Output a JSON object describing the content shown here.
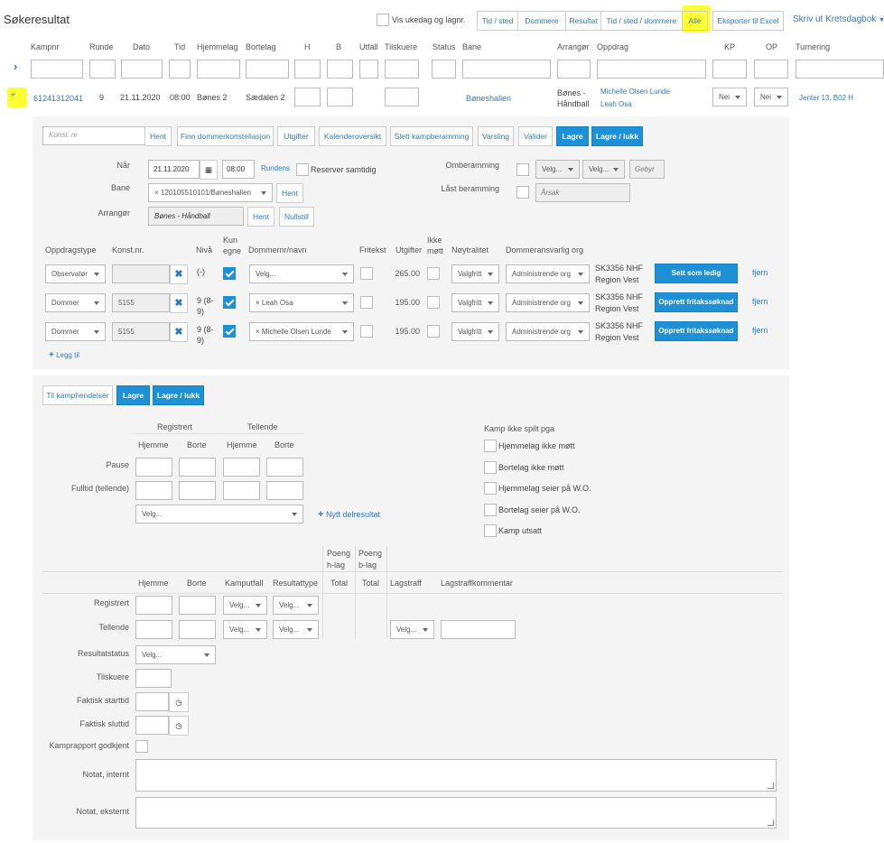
{
  "page": {
    "title": "Søkeresultat"
  },
  "toolbar": {
    "show_weekday_label": "Vis ukedag og lagnr.",
    "filter_buttons": [
      "Tid / sted",
      "Dommere",
      "Resultat",
      "Tid / sted / dommere",
      "Alle"
    ],
    "export_label": "Eksporter til Excel",
    "print_label": "Skriv ut Kretsdagbok"
  },
  "table": {
    "columns": [
      "Kampnr",
      "Runde",
      "Dato",
      "Tid",
      "Hjemmelag",
      "Bortelag",
      "H",
      "B",
      "Utfall",
      "Tilskuere",
      "Status",
      "Bane",
      "Arrangør",
      "Oppdrag",
      "KP",
      "OP",
      "Turnering"
    ],
    "row": {
      "kampnr": "61241312041",
      "runde": "9",
      "dato": "21.11.2020",
      "tid": "08:00",
      "hjemmelag": "Bønes 2",
      "bortelag": "Sædalen 2",
      "bane": "Bøneshallen",
      "arrangor": "Bønes - Håndball",
      "oppdrag1": "Michelle Olsen Lunde",
      "oppdrag2": "Leah Osa",
      "kp": "Nei",
      "op": "Nei",
      "turnering": "Jenter 13, B02 H"
    }
  },
  "match_toolbar": {
    "konst_placeholder": "Konst. nr",
    "hent": "Hent",
    "buttons": [
      "Finn dommerkonstellasjon",
      "Utgifter",
      "Kalenderoversikt",
      "Slett kampberamming",
      "Varsling",
      "Valider"
    ],
    "save": "Lagre",
    "save_close": "Lagre / lukk"
  },
  "scheduling": {
    "naar_label": "Når",
    "date": "21.11.2020",
    "time": "08:00",
    "rundens": "Rundens",
    "reserve_label": "Reserver samtidig",
    "bane_label": "Bane",
    "bane_value": "120105510101/Bøneshallen",
    "bane_hent": "Hent",
    "arrangor_label": "Arrangør",
    "arrangor_value": "Bønes - Håndball",
    "arr_hent": "Hent",
    "nullstill": "Nullstill",
    "omberamming_label": "Omberamming",
    "velg": "Velg...",
    "gebyr": "Gebyr",
    "last_label": "Låst beramming",
    "arsak": "Årsak"
  },
  "assign": {
    "headers": [
      "Oppdragstype",
      "Konst.nr.",
      "Nivå",
      "Kun egne",
      "Dommernr/navn",
      "Fritekst",
      "Utgifter",
      "Ikke møtt",
      "Nøytralitet",
      "Dommeransvarlig org"
    ],
    "rows": [
      {
        "type": "Observatør",
        "konst": "",
        "niva": "(-)",
        "name": "Velg...",
        "utgifter": "265.00",
        "noyt": "Valgfritt",
        "org": "Administrende org",
        "region": "SK3356 NHF Region Vest",
        "action": "Sett som ledig",
        "fjern": "fjern"
      },
      {
        "type": "Dommer",
        "konst": "5155",
        "niva": "9 (8-9)",
        "name": "Leah Osa",
        "utgifter": "195.00",
        "noyt": "Valgfritt",
        "org": "Administrende org",
        "region": "SK3356 NHF Region Vest",
        "action": "Opprett fritakssøknad",
        "fjern": "fjern"
      },
      {
        "type": "Dommer",
        "konst": "5155",
        "niva": "9 (8-9)",
        "name": "Michelle Olsen Lunde",
        "utgifter": "195.00",
        "noyt": "Valgfritt",
        "org": "Administrende org",
        "region": "SK3356 NHF Region Vest",
        "action": "Opprett fritakssøknad",
        "fjern": "fjern"
      }
    ],
    "add": "Legg til"
  },
  "result_toolbar": {
    "events": "Til kamphendelser",
    "save": "Lagre",
    "save_close": "Lagre / lukk"
  },
  "results": {
    "registrert": "Registrert",
    "tellende": "Tellende",
    "hjemme": "Hjemme",
    "borte": "Borte",
    "pause": "Pause",
    "fulltid": "Fulltid (tellende)",
    "velg": "Velg...",
    "nytt": "Nytt delresultat",
    "not_played_title": "Kamp ikke spilt pga",
    "not_played": [
      "Hjemmelag ikke møtt",
      "Bortelag ikke møtt",
      "Hjemmelag seier på W.O.",
      "Bortelag seier på W.O.",
      "Kamp utsatt"
    ],
    "h2": [
      "Hjemme",
      "Borte",
      "Kamputfall",
      "Resultattype",
      "Total",
      "Total",
      "Lagstraff",
      "Lagstraffkommentar"
    ],
    "poeng_h": "Poeng h-lag",
    "poeng_b": "Poeng b-lag",
    "reg_row": "Registrert",
    "tel_row": "Tellende",
    "status_label": "Resultatstatus",
    "tilskuere": "Tilskuere",
    "start": "Faktisk starttid",
    "slutt": "Faktisk sluttid",
    "godkjent": "Kamprapport godkjent",
    "notat_int": "Notat, internt",
    "notat_eks": "Notat, eksternt"
  },
  "colors": {
    "accent": "#1e90d6",
    "link": "#337ab7",
    "highlight": "#ffff00"
  }
}
